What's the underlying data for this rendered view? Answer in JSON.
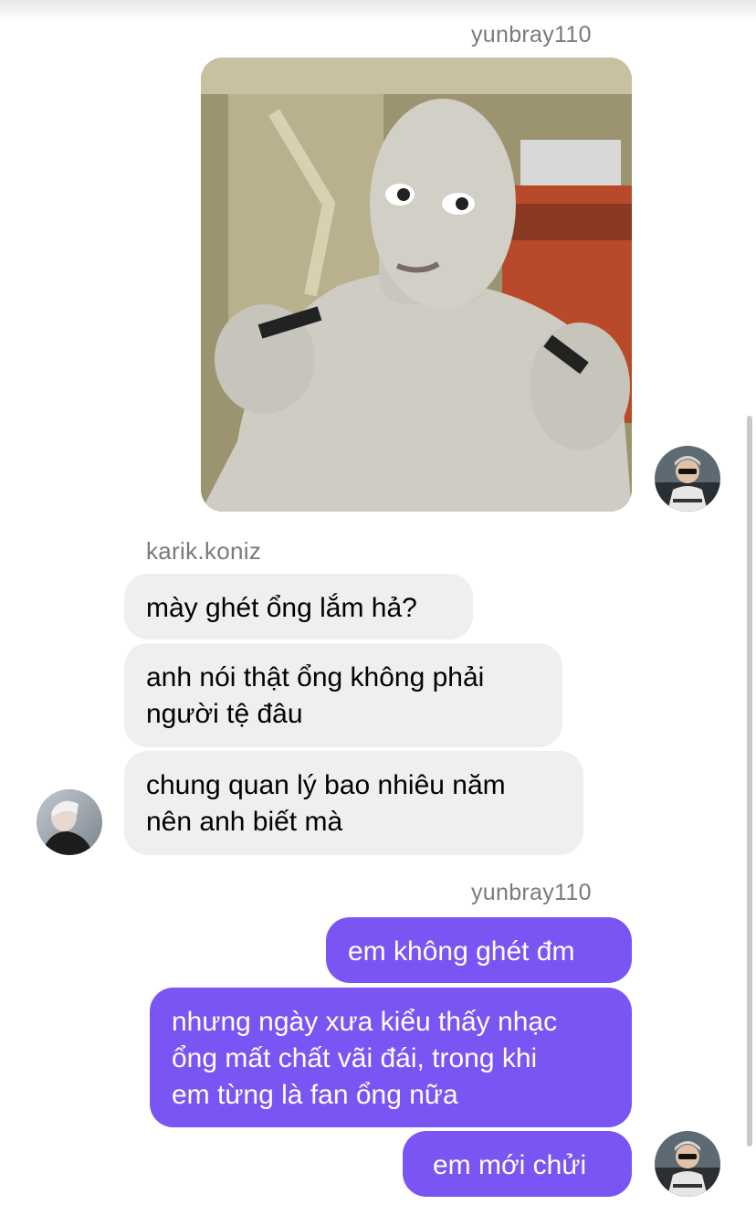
{
  "thread": {
    "messages": [
      {
        "sender": "yunbray110",
        "type": "photo",
        "alt": ""
      },
      {
        "sender": "karik.koniz",
        "text": "mày ghét ổng lắm hả?"
      },
      {
        "sender": "karik.koniz",
        "text": "anh nói thật ổng không phải\nngười tệ đâu"
      },
      {
        "sender": "karik.koniz",
        "text": "chung quan lý bao nhiêu năm\nnên anh biết mà"
      },
      {
        "sender": "yunbray110",
        "text": "em không ghét đm"
      },
      {
        "sender": "yunbray110",
        "text": "nhưng ngày xưa kiểu thấy nhạc\nổng mất chất vãi đái, trong khi\nem từng là fan ổng nữa"
      },
      {
        "sender": "yunbray110",
        "text": "em mới chửi"
      }
    ],
    "labels": {
      "sender_top": "yunbray110",
      "sender_karik": "karik.koniz",
      "sender_bottom": "yunbray110"
    }
  },
  "colors": {
    "outgoing_bubble": "#7a55f3",
    "incoming_bubble": "#efefef",
    "sender_label": "#7a7a7a"
  }
}
